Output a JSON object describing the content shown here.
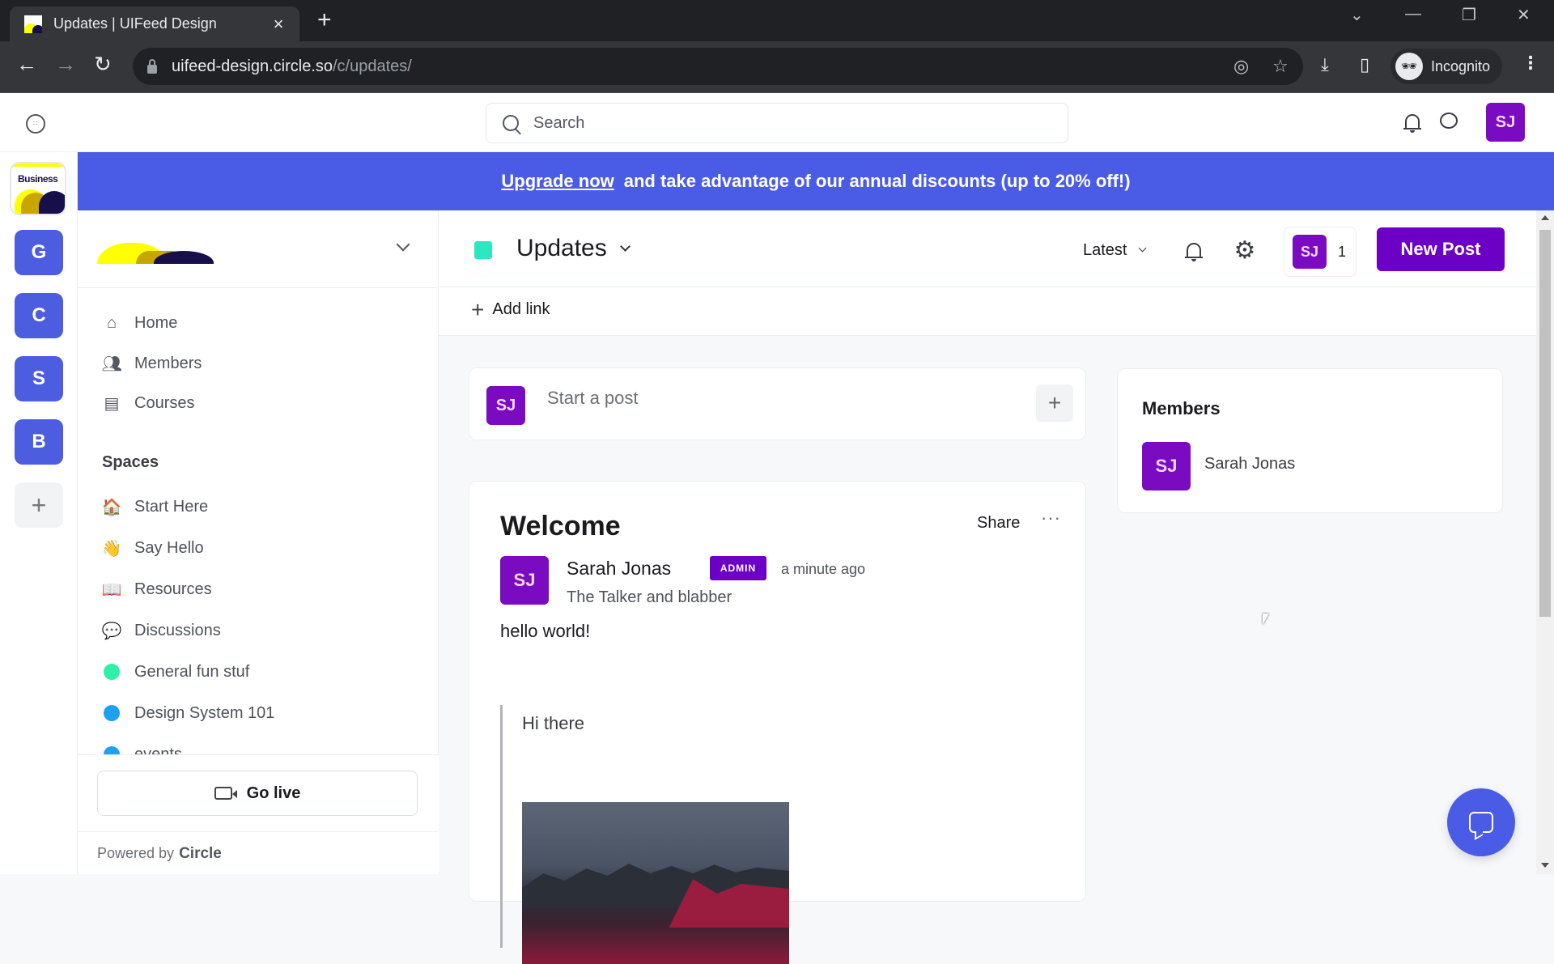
{
  "browser": {
    "tab_title": "Updates | UIFeed Design",
    "tab_close": "×",
    "new_tab": "+",
    "url_host": "uifeed-design.circle.so",
    "url_path": "/c/updates/",
    "profile_label": "Incognito",
    "window_controls": {
      "tab_search": "⌄",
      "minimize": "—",
      "restore": "❐",
      "close": "✕"
    },
    "icons": [
      "back-arrow-icon",
      "forward-arrow-icon",
      "reload-icon",
      "lock-icon",
      "eye-off-icon",
      "star-icon",
      "download-icon",
      "side-panel-icon",
      "incognito-icon",
      "kebab-menu-icon"
    ]
  },
  "header": {
    "search_placeholder": "Search",
    "user_initials": "SJ"
  },
  "banner": {
    "link_text": "Upgrade now",
    "text": "and take advantage of our annual discounts (up to 20% off!)"
  },
  "rail": {
    "business_label": "Business",
    "items": [
      {
        "letter": "G"
      },
      {
        "letter": "C"
      },
      {
        "letter": "S"
      },
      {
        "letter": "B"
      }
    ],
    "add": "+"
  },
  "sidebar": {
    "nav": [
      {
        "label": "Home",
        "icon": "home-icon"
      },
      {
        "label": "Members",
        "icon": "members-icon"
      },
      {
        "label": "Courses",
        "icon": "courses-icon"
      }
    ],
    "spaces_heading": "Spaces",
    "spaces": [
      {
        "label": "Start Here",
        "emoji": "🏠"
      },
      {
        "label": "Say Hello",
        "emoji": "👋"
      },
      {
        "label": "Resources",
        "emoji": "📖"
      },
      {
        "label": "Discussions",
        "emoji": "💬"
      },
      {
        "label": "General fun stuf",
        "dot_color": "#2ef0a8"
      },
      {
        "label": "Design System 101",
        "dot_color": "#1da1f2"
      },
      {
        "label": "events",
        "dot_color": "#1da1f2"
      }
    ],
    "go_live": "Go live",
    "powered_by": "Powered by",
    "powered_brand": "Circle"
  },
  "space": {
    "title": "Updates",
    "swatch_color": "#2ee6c1",
    "sort_label": "Latest",
    "member_initials": "SJ",
    "member_count": "1",
    "new_post": "New Post",
    "add_link": "Add link"
  },
  "composer": {
    "initials": "SJ",
    "placeholder": "Start a post",
    "plus": "+"
  },
  "post": {
    "title": "Welcome",
    "share": "Share",
    "more": "···",
    "author_initials": "SJ",
    "author": "Sarah Jonas",
    "badge": "ADMIN",
    "time": "a minute ago",
    "headline": "The Talker and blabber",
    "body": "hello world!",
    "quote": "Hi there"
  },
  "members_widget": {
    "title": "Members",
    "members": [
      {
        "initials": "SJ",
        "name": "Sarah Jonas"
      }
    ]
  },
  "colors": {
    "accent_purple": "#6c00c4",
    "avatar_purple": "#7a0bc0",
    "banner_blue": "#4a5ce6",
    "rail_blue": "#4c5de0"
  }
}
